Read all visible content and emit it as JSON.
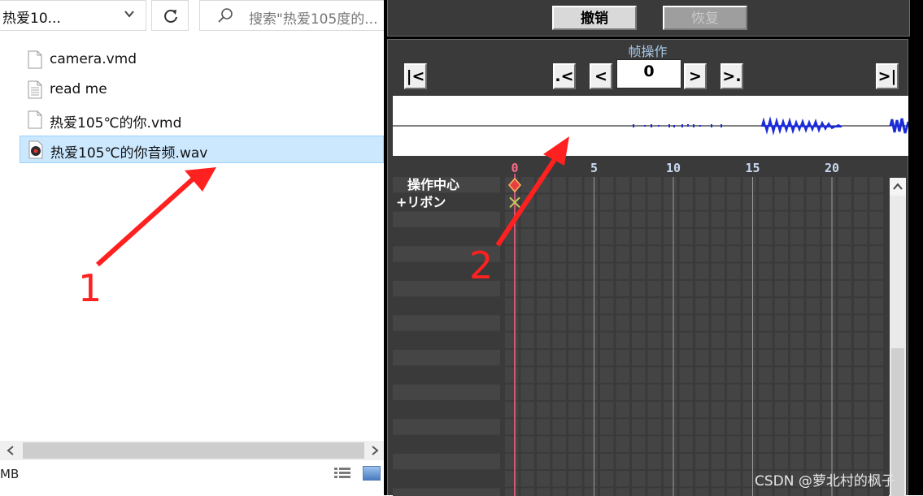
{
  "explorer": {
    "address": "热爱10...",
    "search_placeholder": "搜索\"热爱105度的...",
    "files": [
      {
        "name": "camera.vmd",
        "icon": "document-icon",
        "selected": false
      },
      {
        "name": "read me",
        "icon": "text-document-icon",
        "selected": false
      },
      {
        "name": "热爱105℃的你.vmd",
        "icon": "document-icon",
        "selected": false
      },
      {
        "name": "热爱105℃的你音频.wav",
        "icon": "audio-file-icon",
        "selected": true
      }
    ],
    "status": "MB"
  },
  "mmd": {
    "undo_label": "撤销",
    "redo_label": "恢复",
    "frame_section_title": "帧操作",
    "nav": {
      "first": "|<",
      "prev_key": ".<",
      "prev": "<",
      "frame_value": "0",
      "next": ">",
      "next_key": ">.",
      "last": ">|"
    },
    "ruler": [
      "0",
      "5",
      "10",
      "15",
      "20"
    ],
    "tracks": [
      "操作中心",
      "+リボン"
    ]
  },
  "annotations": {
    "label1": "1",
    "label2": "2",
    "color": "#ff2020"
  },
  "watermark": "CSDN @萝北村的枫子"
}
